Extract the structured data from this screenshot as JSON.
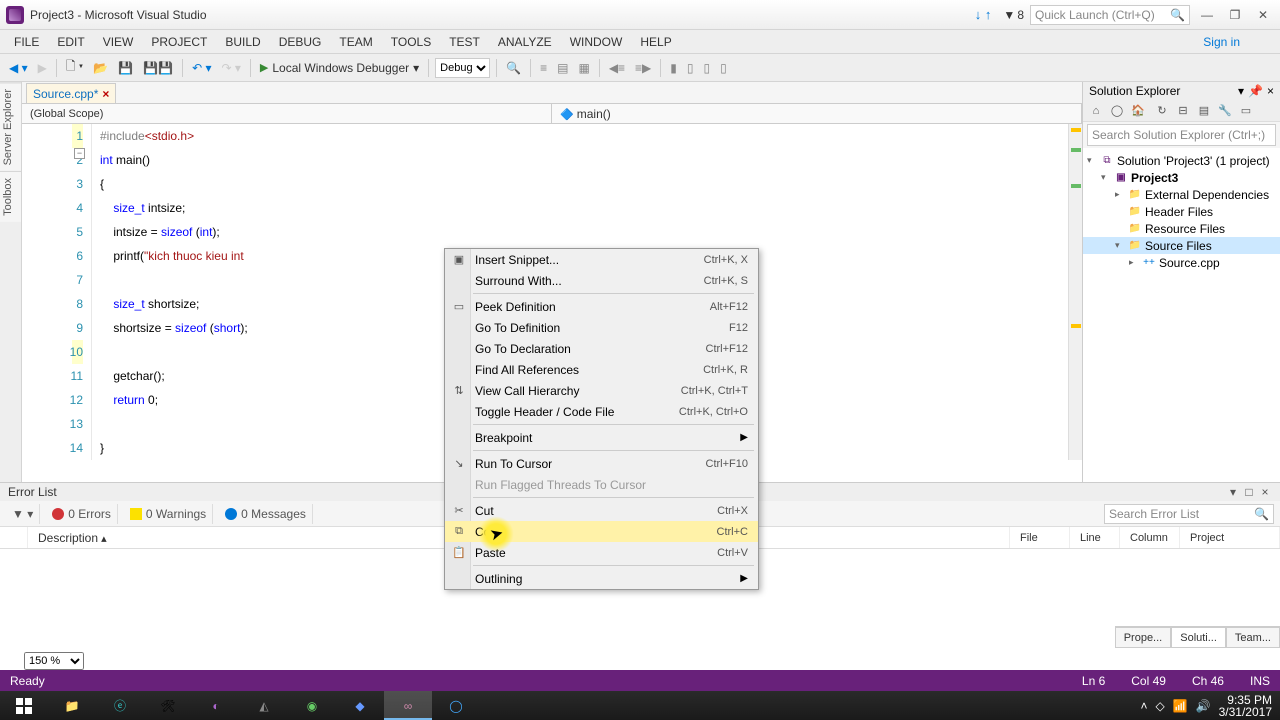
{
  "titlebar": {
    "title": "Project3 - Microsoft Visual Studio",
    "notif_count": "8",
    "quicklaunch_placeholder": "Quick Launch (Ctrl+Q)"
  },
  "menu": {
    "items": [
      "FILE",
      "EDIT",
      "VIEW",
      "PROJECT",
      "BUILD",
      "DEBUG",
      "TEAM",
      "TOOLS",
      "TEST",
      "ANALYZE",
      "WINDOW",
      "HELP"
    ],
    "signin": "Sign in"
  },
  "toolbar": {
    "debugger": "Local Windows Debugger",
    "config": "Debug"
  },
  "tabs": {
    "active": "Source.cpp*"
  },
  "scope": {
    "left": "(Global Scope)",
    "right": "main()"
  },
  "code": {
    "lines": [
      {
        "n": "1",
        "html": "<span class='pp'>#include</span><span class='inc'>&lt;stdio.h&gt;</span>"
      },
      {
        "n": "2",
        "html": "<span class='kw'>int</span> main()"
      },
      {
        "n": "3",
        "html": "{"
      },
      {
        "n": "4",
        "html": "    <span class='kw'>size_t</span> intsize;"
      },
      {
        "n": "5",
        "html": "    intsize = <span class='kw'>sizeof</span> (<span class='kw'>int</span>);"
      },
      {
        "n": "6",
        "html": "    printf(<span class='str'>\"kich thuoc kieu int</span>"
      },
      {
        "n": "7",
        "html": ""
      },
      {
        "n": "8",
        "html": "    <span class='kw'>size_t</span> shortsize;"
      },
      {
        "n": "9",
        "html": "    shortsize = <span class='kw'>sizeof</span> (<span class='kw'>short</span>);"
      },
      {
        "n": "10",
        "html": ""
      },
      {
        "n": "11",
        "html": "    getchar();"
      },
      {
        "n": "12",
        "html": "    <span class='kw'>return</span> 0;"
      },
      {
        "n": "13",
        "html": ""
      },
      {
        "n": "14",
        "html": "}"
      }
    ]
  },
  "context_menu": {
    "items": [
      {
        "label": "Insert Snippet...",
        "shortcut": "Ctrl+K, X",
        "icon": "▣"
      },
      {
        "label": "Surround With...",
        "shortcut": "Ctrl+K, S"
      },
      {
        "sep": true
      },
      {
        "label": "Peek Definition",
        "shortcut": "Alt+F12",
        "icon": "▭"
      },
      {
        "label": "Go To Definition",
        "shortcut": "F12"
      },
      {
        "label": "Go To Declaration",
        "shortcut": "Ctrl+F12"
      },
      {
        "label": "Find All References",
        "shortcut": "Ctrl+K, R"
      },
      {
        "label": "View Call Hierarchy",
        "shortcut": "Ctrl+K, Ctrl+T",
        "icon": "⇅"
      },
      {
        "label": "Toggle Header / Code File",
        "shortcut": "Ctrl+K, Ctrl+O"
      },
      {
        "sep": true
      },
      {
        "label": "Breakpoint",
        "submenu": true
      },
      {
        "sep": true
      },
      {
        "label": "Run To Cursor",
        "shortcut": "Ctrl+F10",
        "icon": "↘"
      },
      {
        "label": "Run Flagged Threads To Cursor",
        "disabled": true
      },
      {
        "sep": true
      },
      {
        "label": "Cut",
        "shortcut": "Ctrl+X",
        "icon": "✂"
      },
      {
        "label": "Copy",
        "shortcut": "Ctrl+C",
        "hover": true,
        "icon": "⧉"
      },
      {
        "label": "Paste",
        "shortcut": "Ctrl+V",
        "icon": "📋"
      },
      {
        "sep": true
      },
      {
        "label": "Outlining",
        "submenu": true
      }
    ]
  },
  "errorlist": {
    "title": "Error List",
    "filters": {
      "errors": "0 Errors",
      "warnings": "0 Warnings",
      "messages": "0 Messages"
    },
    "search_placeholder": "Search Error List",
    "columns": [
      "Description",
      "File",
      "Line",
      "Column",
      "Project"
    ]
  },
  "rail": {
    "tabs": [
      "Server Explorer",
      "Toolbox"
    ]
  },
  "zoom": "150 %",
  "bottom_panels": [
    "Prope...",
    "Soluti...",
    "Team..."
  ],
  "status": {
    "ready": "Ready",
    "ln": "Ln 6",
    "col": "Col 49",
    "ch": "Ch 46",
    "ins": "INS"
  },
  "solution": {
    "title": "Solution Explorer",
    "search_placeholder": "Search Solution Explorer (Ctrl+;)",
    "tree": [
      {
        "indent": 0,
        "exp": "▾",
        "icon": "sln",
        "label": "Solution 'Project3' (1 project)"
      },
      {
        "indent": 1,
        "exp": "▾",
        "icon": "prj",
        "label": "Project3",
        "bold": true
      },
      {
        "indent": 2,
        "exp": "▸",
        "icon": "fld",
        "label": "External Dependencies"
      },
      {
        "indent": 2,
        "exp": "",
        "icon": "fld",
        "label": "Header Files"
      },
      {
        "indent": 2,
        "exp": "",
        "icon": "fld",
        "label": "Resource Files"
      },
      {
        "indent": 2,
        "exp": "▾",
        "icon": "fld",
        "label": "Source Files",
        "sel": true
      },
      {
        "indent": 3,
        "exp": "▸",
        "icon": "cpp",
        "label": "Source.cpp"
      }
    ]
  },
  "taskbar": {
    "time": "9:35 PM",
    "date": "3/31/2017"
  }
}
